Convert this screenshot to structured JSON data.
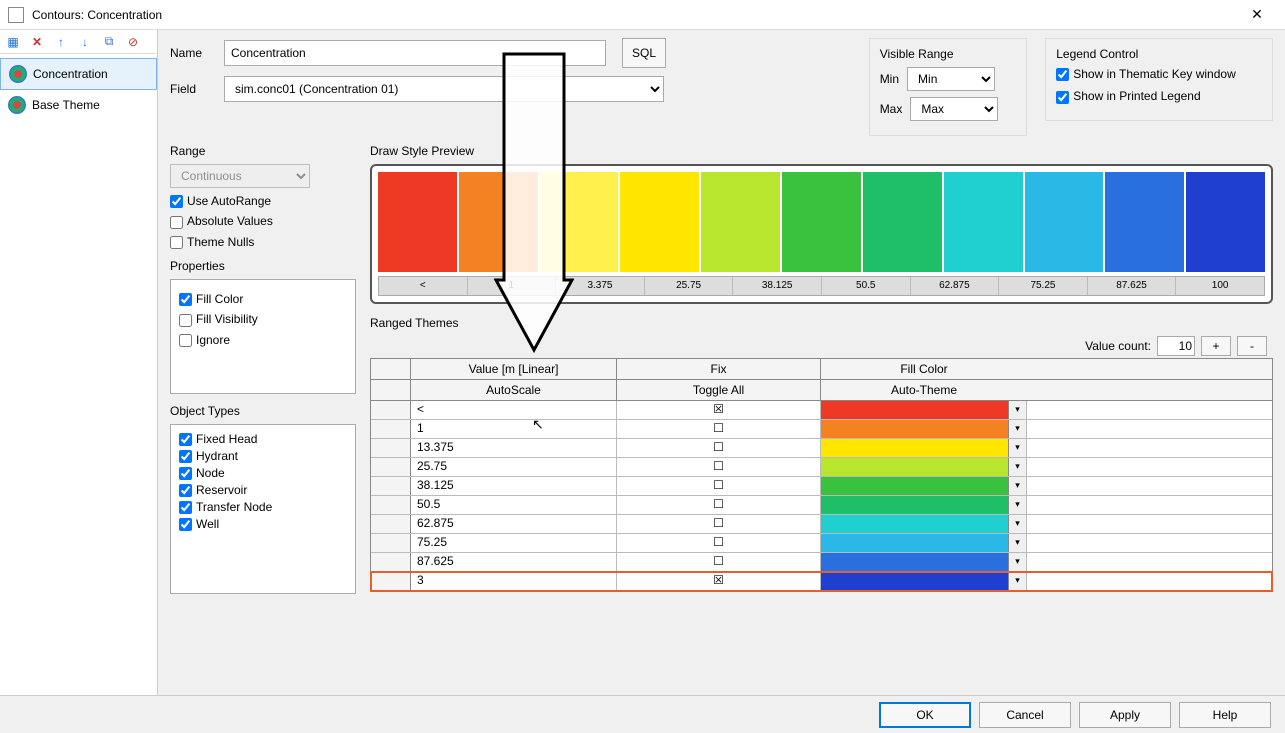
{
  "window": {
    "title": "Contours: Concentration"
  },
  "sidebar": {
    "items": [
      {
        "label": "Concentration"
      },
      {
        "label": "Base Theme"
      }
    ]
  },
  "form": {
    "name_label": "Name",
    "name_value": "Concentration",
    "sql_label": "SQL",
    "field_label": "Field",
    "field_value": "sim.conc01 (Concentration 01)"
  },
  "visible_range": {
    "title": "Visible Range",
    "min_label": "Min",
    "min_value": "Min",
    "max_label": "Max",
    "max_value": "Max"
  },
  "legend_control": {
    "title": "Legend Control",
    "thematic": "Show in Thematic Key window",
    "printed": "Show in Printed Legend"
  },
  "range": {
    "title": "Range",
    "mode": "Continuous",
    "auto_range": "Use AutoRange",
    "absolute": "Absolute Values",
    "theme_nulls": "Theme Nulls"
  },
  "properties": {
    "title": "Properties",
    "fill_color": "Fill Color",
    "fill_visibility": "Fill Visibility",
    "ignore": "Ignore"
  },
  "object_types": {
    "title": "Object Types",
    "items": [
      "Fixed Head",
      "Hydrant",
      "Node",
      "Reservoir",
      "Transfer Node",
      "Well"
    ]
  },
  "preview": {
    "title": "Draw Style Preview",
    "colors": [
      "#ee3a24",
      "#f58220",
      "#fff04d",
      "#ffe600",
      "#b8e62e",
      "#3ac23e",
      "#1fbf6a",
      "#20cfcf",
      "#2ab8e6",
      "#2a6fe0",
      "#1f3fd0"
    ],
    "ticks": [
      "<",
      "1",
      "3.375",
      "25.75",
      "38.125",
      "50.5",
      "62.875",
      "75.25",
      "87.625",
      "100"
    ]
  },
  "ranged": {
    "title": "Ranged Themes",
    "value_count_label": "Value count:",
    "value_count": "10",
    "plus": "+",
    "minus": "-",
    "header_value": "Value [m   [Linear]",
    "header_fix": "Fix",
    "header_fill": "Fill Color",
    "sub_autoscale": "AutoScale",
    "sub_toggle": "Toggle All",
    "sub_autotheme": "Auto-Theme",
    "rows": [
      {
        "value": "<",
        "fix": true,
        "color": "#ee3a24"
      },
      {
        "value": "1",
        "fix": false,
        "color": "#f58220"
      },
      {
        "value": "13.375",
        "fix": false,
        "color": "#ffe600"
      },
      {
        "value": "25.75",
        "fix": false,
        "color": "#b8e62e"
      },
      {
        "value": "38.125",
        "fix": false,
        "color": "#3ac23e"
      },
      {
        "value": "50.5",
        "fix": false,
        "color": "#1fbf6a"
      },
      {
        "value": "62.875",
        "fix": false,
        "color": "#20cfcf"
      },
      {
        "value": "75.25",
        "fix": false,
        "color": "#2ab8e6"
      },
      {
        "value": "87.625",
        "fix": false,
        "color": "#2a6fe0"
      },
      {
        "value": "3",
        "fix": true,
        "color": "#1f3fd0",
        "selected": true
      }
    ]
  },
  "footer": {
    "ok": "OK",
    "cancel": "Cancel",
    "apply": "Apply",
    "help": "Help"
  }
}
